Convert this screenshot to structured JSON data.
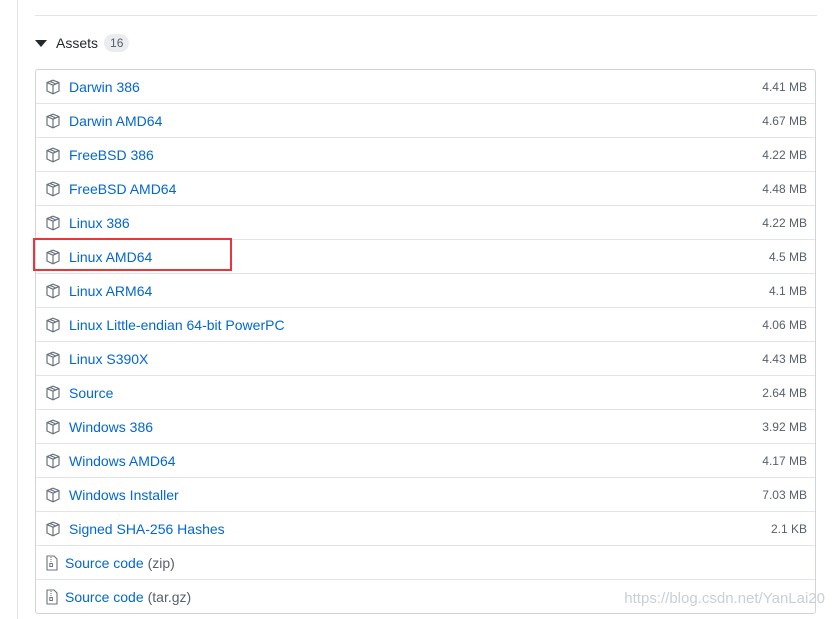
{
  "assets": {
    "label": "Assets",
    "count": "16",
    "items": [
      {
        "name": "Darwin 386",
        "size": "4.41 MB",
        "icon": "package-icon"
      },
      {
        "name": "Darwin AMD64",
        "size": "4.67 MB",
        "icon": "package-icon"
      },
      {
        "name": "FreeBSD 386",
        "size": "4.22 MB",
        "icon": "package-icon"
      },
      {
        "name": "FreeBSD AMD64",
        "size": "4.48 MB",
        "icon": "package-icon"
      },
      {
        "name": "Linux 386",
        "size": "4.22 MB",
        "icon": "package-icon"
      },
      {
        "name": "Linux AMD64",
        "size": "4.5 MB",
        "icon": "package-icon"
      },
      {
        "name": "Linux ARM64",
        "size": "4.1 MB",
        "icon": "package-icon"
      },
      {
        "name": "Linux Little-endian 64-bit PowerPC",
        "size": "4.06 MB",
        "icon": "package-icon"
      },
      {
        "name": "Linux S390X",
        "size": "4.43 MB",
        "icon": "package-icon"
      },
      {
        "name": "Source",
        "size": "2.64 MB",
        "icon": "package-icon"
      },
      {
        "name": "Windows 386",
        "size": "3.92 MB",
        "icon": "package-icon"
      },
      {
        "name": "Windows AMD64",
        "size": "4.17 MB",
        "icon": "package-icon"
      },
      {
        "name": "Windows Installer",
        "size": "7.03 MB",
        "icon": "package-icon"
      },
      {
        "name": "Signed SHA-256 Hashes",
        "size": "2.1 KB",
        "icon": "package-icon"
      }
    ],
    "source_code": [
      {
        "name": "Source code",
        "suffix": "(zip)",
        "icon": "file-zip-icon"
      },
      {
        "name": "Source code",
        "suffix": "(tar.gz)",
        "icon": "file-zip-icon"
      }
    ]
  },
  "highlight_color": "#e8363a",
  "link_color": "#0366d6",
  "watermark": "https://blog.csdn.net/YanLai20"
}
